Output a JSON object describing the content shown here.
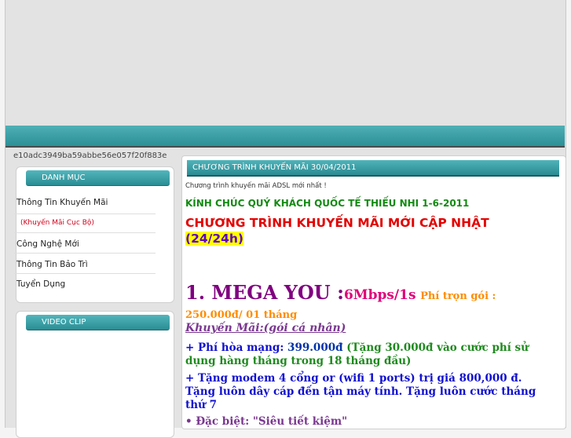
{
  "site": {
    "hash": "e10adc3949ba59abbe56e057f20f883e"
  },
  "sidebar": {
    "menu_title": "DANH MỤC",
    "items": [
      "Thông Tin Khuyến Mãi",
      "(Khuyến Mãi Cục Bộ)",
      "Công Nghệ Mới",
      "Thông Tin Bảo Trì",
      "Tuyển Dụng"
    ],
    "video_title": "VIDEO CLIP"
  },
  "content": {
    "header": "CHƯƠNG TRÌNH KHUYẾN MÃI 30/04/2011",
    "subtitle": "Chương trình khuyến mãi ADSL mới nhất !",
    "greeting": "KÍNH CHÚC QUÝ KHÁCH QUỐC TẾ THIẾU NHI 1-6-2011",
    "promo_title": "CHƯƠNG TRÌNH KHUYẾN MÃI MỚI CẬP NHẬT",
    "promo_24h": "(24/24h)",
    "package": "1. MEGA YOU :",
    "speed": "6Mbps/1s",
    "fee": "Phí trọn gói : 250.000đ/ 01 tháng",
    "km_title": "Khuyến Mãi:(gói cá nhân)",
    "line1_a": "+ Phí hòa mạng: ",
    "line1_b": "399.000đ",
    "line1_c": " (Tặng 30.000đ vào cước phí sử dụng hàng tháng trong 18 tháng đầu)",
    "line2": "+ Tặng modem 4 cổng or (wifi 1 ports) trị giá 800,000 đ. Tặng luôn dây cáp đến tận máy tính. Tặng luôn cước tháng thứ 7",
    "line3_a": "• Đặc biệt: ",
    "line3_b": "\"Siêu tiết kiệm\""
  }
}
